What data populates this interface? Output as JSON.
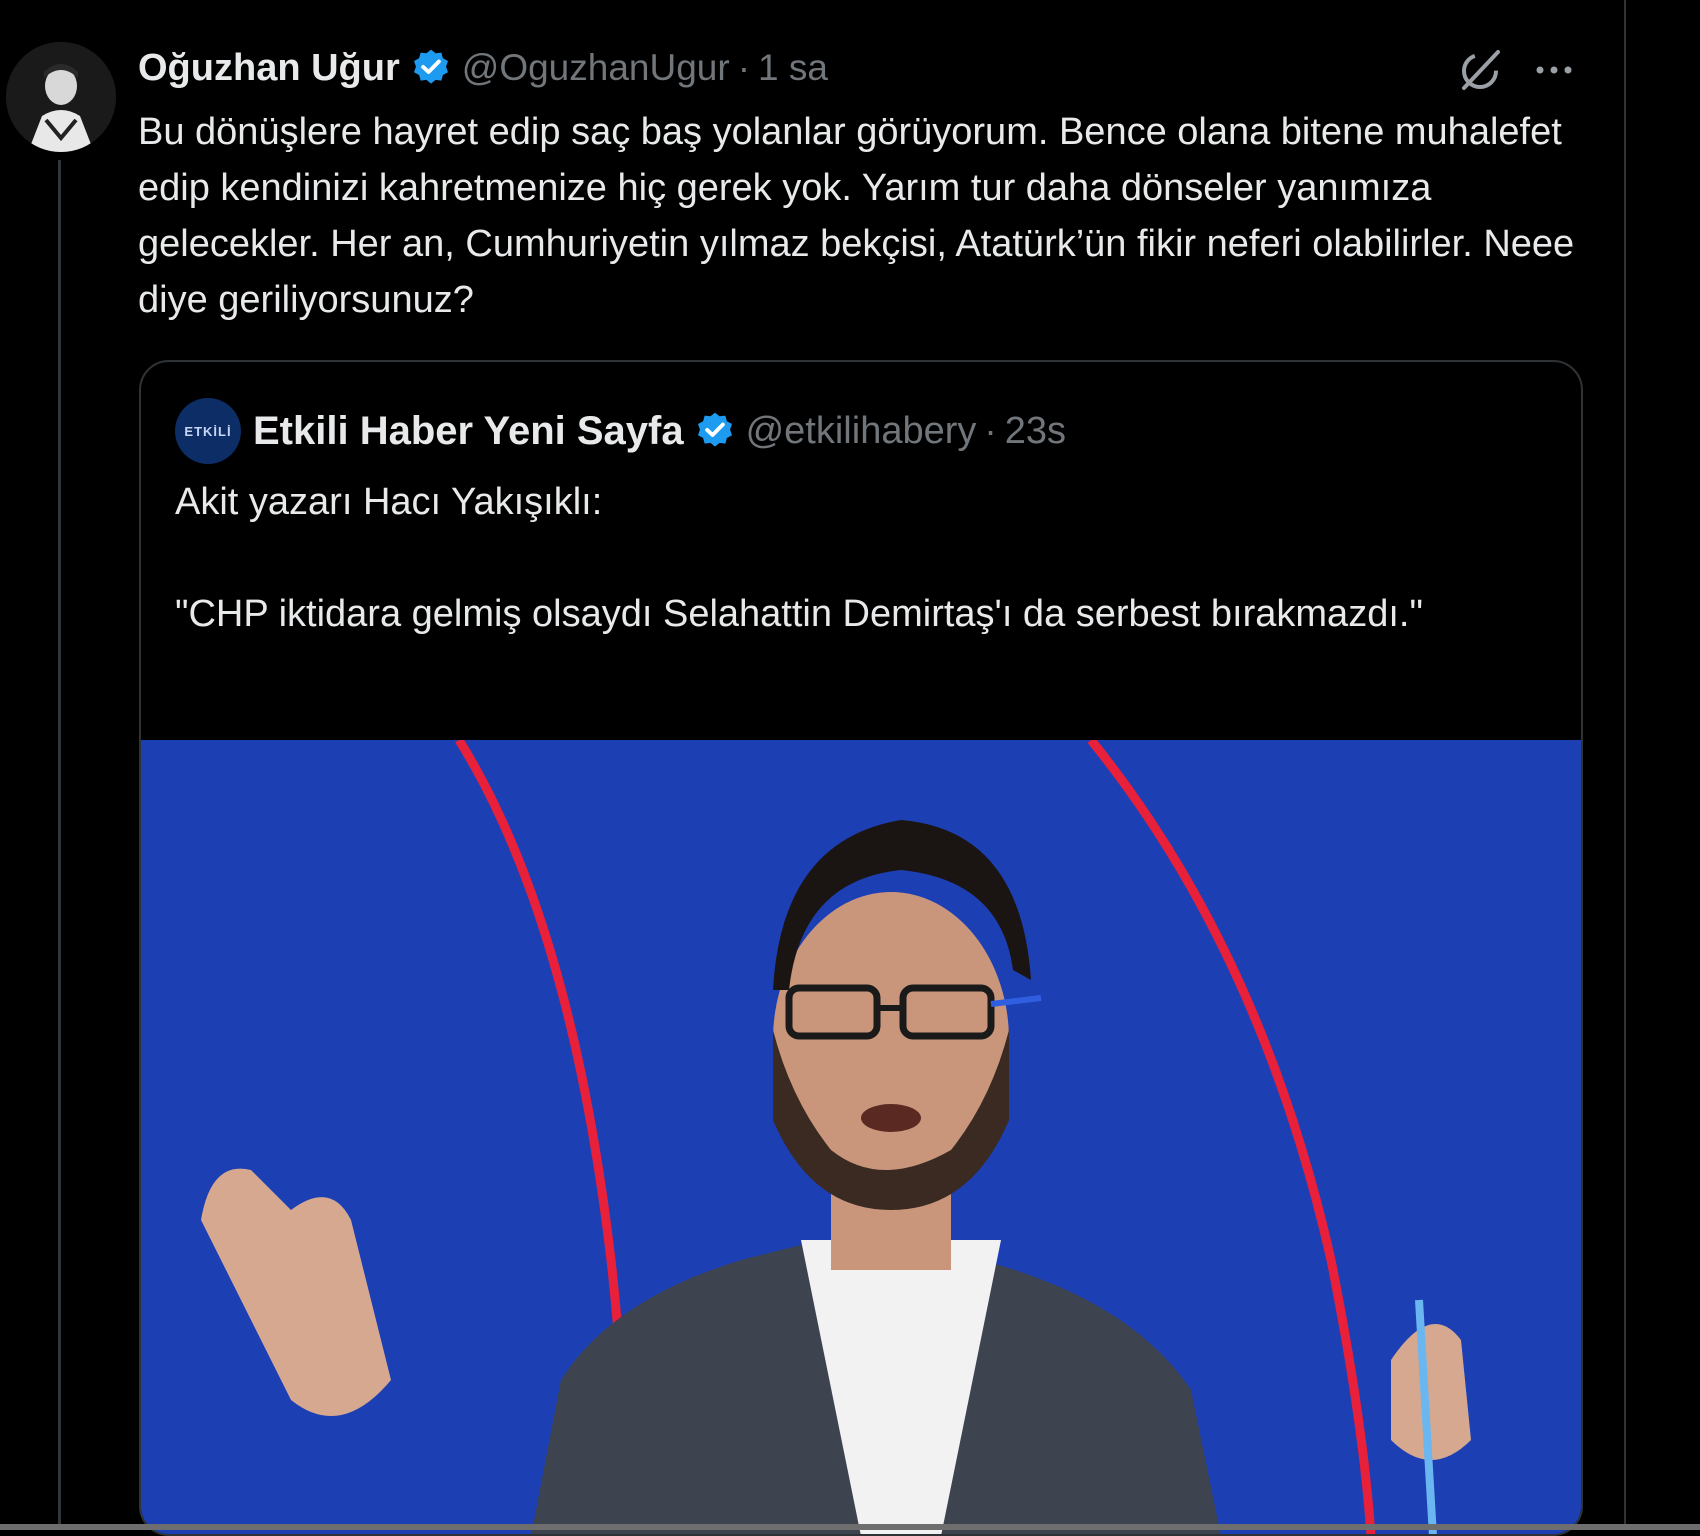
{
  "tweet": {
    "author_name": "Oğuzhan Uğur",
    "handle": "@OguzhanUgur",
    "separator": "·",
    "time": "1 sa",
    "text": "Bu dönüşlere hayret edip saç baş yolanlar görüyorum. Bence olana bitene muhalefet edip kendinizi kahretmenize hiç gerek yok. Yarım tur daha dönseler yanımıza gelecekler. Her an, Cumhuriyetin yılmaz bekçisi, Atatürk’ün fikir neferi olabilirler. Neee diye geriliyorsunuz?"
  },
  "quote": {
    "avatar_text": "ETKİLİ",
    "author_name": "Etkili Haber Yeni Sayfa",
    "handle": "@etkilihabery",
    "separator": "·",
    "time": "23s",
    "line1": "Akit yazarı Hacı Yakışıklı:",
    "line2": "\"CHP iktidara gelmiş olsaydı Selahattin Demirtaş'ı da serbest bırakmazdı.\""
  },
  "icons": {
    "verified": "verified-badge-icon",
    "grok": "grok-icon",
    "more": "more-icon"
  },
  "colors": {
    "background": "#000000",
    "verified_blue": "#1d9bf0",
    "media_blue": "#1d3fb4",
    "media_red": "#e8203a",
    "muted": "#71767b"
  }
}
